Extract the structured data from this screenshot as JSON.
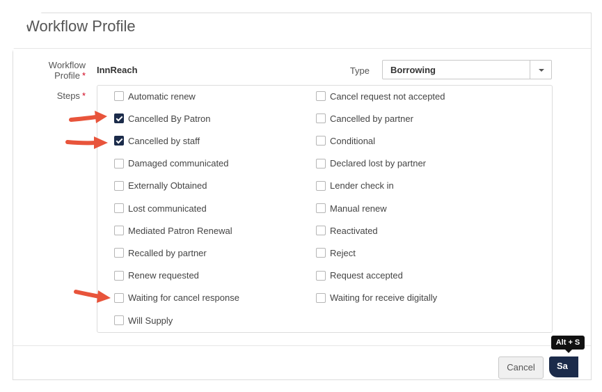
{
  "dialog": {
    "title": "it Workflow Profile"
  },
  "form": {
    "profile_label_line1": "Workflow",
    "profile_label_line2": "Profile",
    "required_mark": "*",
    "profile_value": "InnReach",
    "type_label": "Type",
    "type_value": "Borrowing",
    "steps_label": "Steps"
  },
  "steps": [
    {
      "label": "Automatic renew",
      "checked": false
    },
    {
      "label": "Cancel request not accepted",
      "checked": false
    },
    {
      "label": "Cancelled By Patron",
      "checked": true
    },
    {
      "label": "Cancelled by partner",
      "checked": false
    },
    {
      "label": "Cancelled by staff",
      "checked": true
    },
    {
      "label": "Conditional",
      "checked": false
    },
    {
      "label": "Damaged communicated",
      "checked": false
    },
    {
      "label": "Declared lost by partner",
      "checked": false
    },
    {
      "label": "Externally Obtained",
      "checked": false
    },
    {
      "label": "Lender check in",
      "checked": false
    },
    {
      "label": "Lost communicated",
      "checked": false
    },
    {
      "label": "Manual renew",
      "checked": false
    },
    {
      "label": "Mediated Patron Renewal",
      "checked": false
    },
    {
      "label": "Reactivated",
      "checked": false
    },
    {
      "label": "Recalled by partner",
      "checked": false
    },
    {
      "label": "Reject",
      "checked": false
    },
    {
      "label": "Renew requested",
      "checked": false
    },
    {
      "label": "Request accepted",
      "checked": false
    },
    {
      "label": "Waiting for cancel response",
      "checked": false
    },
    {
      "label": "Waiting for receive digitally",
      "checked": false
    },
    {
      "label": "Will Supply",
      "checked": false
    }
  ],
  "footer": {
    "cancel_label": "Cancel",
    "save_label": "Sa",
    "tooltip": "Alt + S"
  },
  "colors": {
    "accent": "#1b2b4a",
    "annotation_arrow": "#e8543b",
    "required": "#d0021b"
  }
}
